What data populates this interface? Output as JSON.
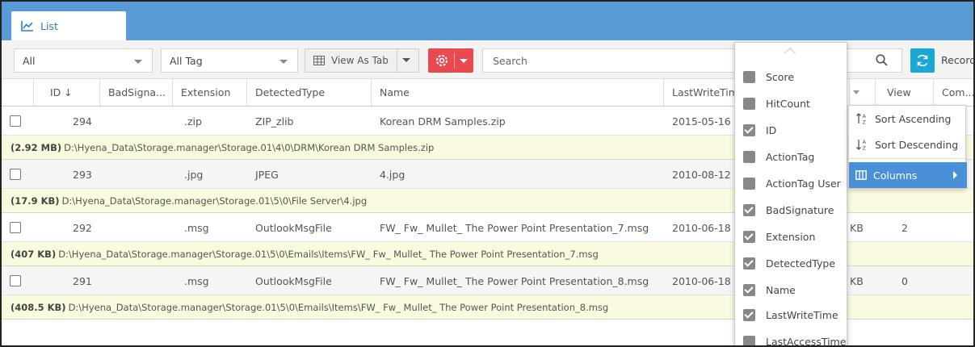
{
  "tab": {
    "label": "List",
    "icon": "line-chart-icon"
  },
  "toolbar": {
    "filter1": "All",
    "filter2": "All Tag",
    "view_label": "View As Tab",
    "search_placeholder": "Search",
    "records_label": "Records"
  },
  "columns": [
    "ID ↓",
    "BadSigna...",
    "Extension",
    "DetectedType",
    "Name",
    "LastWriteTim",
    "View",
    "Com..."
  ],
  "rows": [
    {
      "id": "294",
      "ext": ".zip",
      "type": "ZIP_zlib",
      "name": "Korean DRM Samples.zip",
      "lastwrite": "2015-05-16 2",
      "size_col": "",
      "view": "",
      "size": "(2.92 MB)",
      "path": "D:\\Hyena_Data\\Storage.manager\\Storage.01\\4\\0\\DRM\\Korean DRM Samples.zip"
    },
    {
      "id": "293",
      "ext": ".jpg",
      "type": "JPEG",
      "name": "4.jpg",
      "lastwrite": "2010-08-12 1",
      "size_col": "",
      "view": "",
      "size": "(17.9 KB)",
      "path": "D:\\Hyena_Data\\Storage.manager\\Storage.01\\5\\0\\File Server\\4.jpg"
    },
    {
      "id": "292",
      "ext": ".msg",
      "type": "OutlookMsgFile",
      "name": "FW_ Fw_ Mullet_ The Power Point Presentation_7.msg",
      "lastwrite": "2010-06-18 0",
      "size_col": "KB",
      "view": "2",
      "size": "(407 KB)",
      "path": "D:\\Hyena_Data\\Storage.manager\\Storage.01\\5\\0\\Emails\\Items\\FW_ Fw_ Mullet_ The Power Point Presentation_7.msg"
    },
    {
      "id": "291",
      "ext": ".msg",
      "type": "OutlookMsgFile",
      "name": "FW_ Fw_ Mullet_ The Power Point Presentation_8.msg",
      "lastwrite": "2010-06-18 0",
      "size_col": "KB",
      "view": "0",
      "size": "(408.5 KB)",
      "path": "D:\\Hyena_Data\\Storage.manager\\Storage.01\\5\\0\\Emails\\Items\\FW_ Fw_ Mullet_ The Power Point Presentation_8.msg"
    }
  ],
  "column_menu": [
    {
      "label": "Score",
      "checked": false
    },
    {
      "label": "HitCount",
      "checked": false
    },
    {
      "label": "ID",
      "checked": true
    },
    {
      "label": "ActionTag",
      "checked": false
    },
    {
      "label": "ActionTag User",
      "checked": false
    },
    {
      "label": "BadSignature",
      "checked": true
    },
    {
      "label": "Extension",
      "checked": true
    },
    {
      "label": "DetectedType",
      "checked": true
    },
    {
      "label": "Name",
      "checked": true
    },
    {
      "label": "LastWriteTime",
      "checked": true
    },
    {
      "label": "LastAccessTime",
      "checked": false
    }
  ],
  "context_menu": {
    "sort_asc": "Sort Ascending",
    "sort_desc": "Sort Descending",
    "columns": "Columns"
  },
  "colors": {
    "tabbar": "#5b9bd5",
    "gear_button": "#e84a50",
    "refresh_button": "#1ba8d5",
    "path_row": "#fafadf",
    "menu_active": "#4a90d9"
  }
}
